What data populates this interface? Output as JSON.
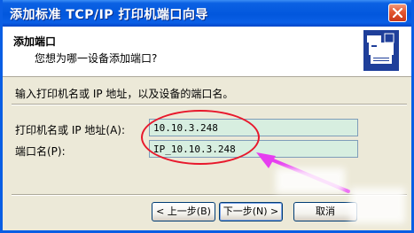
{
  "window": {
    "title": "添加标准 TCP/IP 打印机端口向导"
  },
  "header": {
    "title": "添加端口",
    "subtitle": "您想为哪一设备添加端口?"
  },
  "instruction": "输入打印机名或 IP 地址，以及设备的端口名。",
  "form": {
    "printer_label": "打印机名或 IP 地址(A):",
    "printer_value": "10.10.3.248",
    "port_label": "端口名(P):",
    "port_value": "IP_10.10.3.248"
  },
  "buttons": {
    "back": "< 上一步(B)",
    "next": "下一步(N) >",
    "cancel": "取消"
  },
  "colors": {
    "titlebar": "#0257dd",
    "annotation": "#e8182c",
    "arrow": "#e63ef0",
    "field_bg": "#d7eee0"
  }
}
